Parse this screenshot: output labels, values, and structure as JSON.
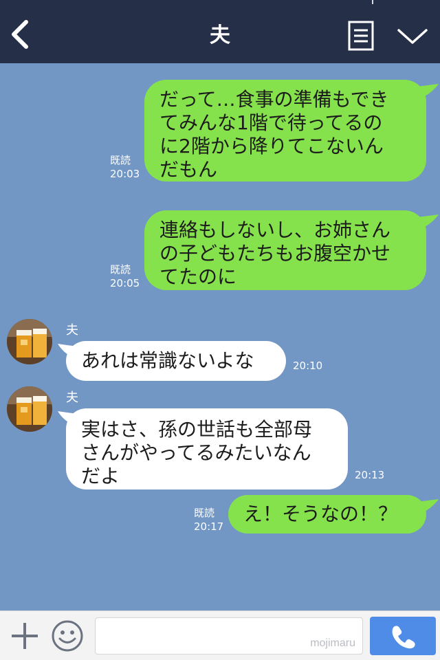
{
  "header": {
    "title": "夫",
    "back_icon": "chevron-left-icon",
    "menu_icon": "menu-list-icon",
    "expand_icon": "chevron-down-icon"
  },
  "messages": [
    {
      "direction": "out",
      "lines": [
        "だって…食事の準備もでき",
        "てみんな1階で待ってるの",
        "に2階から降りてこないん",
        "だもん"
      ],
      "read": "既読",
      "time": "20:03"
    },
    {
      "direction": "out",
      "lines": [
        "連絡もしないし、お姉さん",
        "の子どもたちもお腹空かせ",
        "てたのに"
      ],
      "read": "既読",
      "time": "20:05"
    },
    {
      "direction": "in",
      "sender": "夫",
      "lines": [
        "あれは常識ないよな"
      ],
      "time": "20:10"
    },
    {
      "direction": "in",
      "sender": "夫",
      "lines": [
        "実はさ、孫の世話も全部母",
        "さんがやってるみたいなん",
        "だよ"
      ],
      "time": "20:13"
    },
    {
      "direction": "out",
      "lines": [
        "え！そうなの！？"
      ],
      "read": "既読",
      "time": "20:17"
    }
  ],
  "footer": {
    "plus_icon": "plus-icon",
    "emoji_icon": "smiley-icon",
    "input_value": "",
    "watermark": "mojimaru",
    "call_icon": "phone-icon"
  },
  "colors": {
    "header_bg": "#252f48",
    "chat_bg": "#7397c5",
    "outgoing_bubble": "#86e24c",
    "incoming_bubble": "#ffffff",
    "call_button": "#4e8ce8"
  }
}
